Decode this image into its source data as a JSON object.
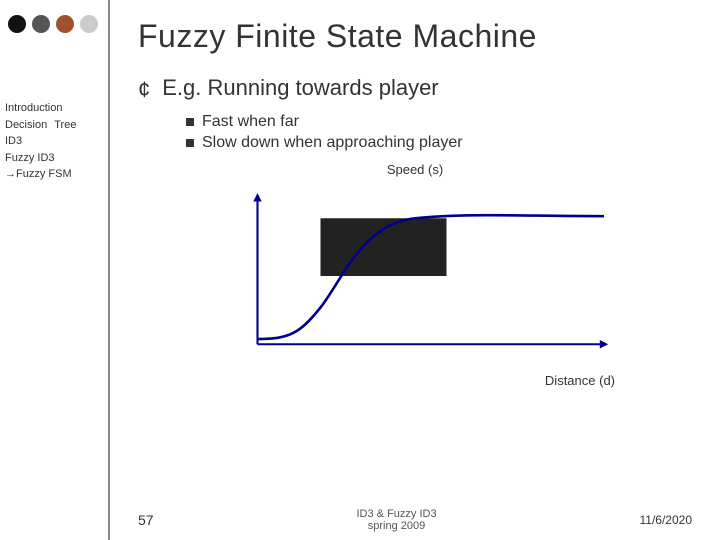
{
  "sidebar": {
    "dots": [
      {
        "color": "dot-black",
        "name": "dot-1"
      },
      {
        "color": "dot-dark",
        "name": "dot-2"
      },
      {
        "color": "dot-brown",
        "name": "dot-3"
      },
      {
        "color": "dot-light",
        "name": "dot-4"
      }
    ],
    "items": [
      {
        "label": "Introduction",
        "active": false,
        "arrow": false
      },
      {
        "label": "Decision  Tree",
        "active": false,
        "arrow": false
      },
      {
        "label": "ID3",
        "active": false,
        "arrow": false
      },
      {
        "label": "Fuzzy ID3",
        "active": false,
        "arrow": false
      },
      {
        "label": "→Fuzzy  FSM",
        "active": true,
        "arrow": true
      }
    ]
  },
  "main": {
    "title": "Fuzzy Finite State Machine",
    "section": {
      "circle": "¢",
      "heading": "E.g. Running towards player",
      "bullets": [
        {
          "text": "Fast when far"
        },
        {
          "text": "Slow down when approaching player"
        }
      ]
    },
    "chart": {
      "y_label": "Speed (s)",
      "x_label": "Distance (d)",
      "highlight_color": "#333"
    }
  },
  "footer": {
    "page_number": "57",
    "center_text": "ID3 & Fuzzy ID3\nspring 2009",
    "date": "11/6/2020"
  }
}
